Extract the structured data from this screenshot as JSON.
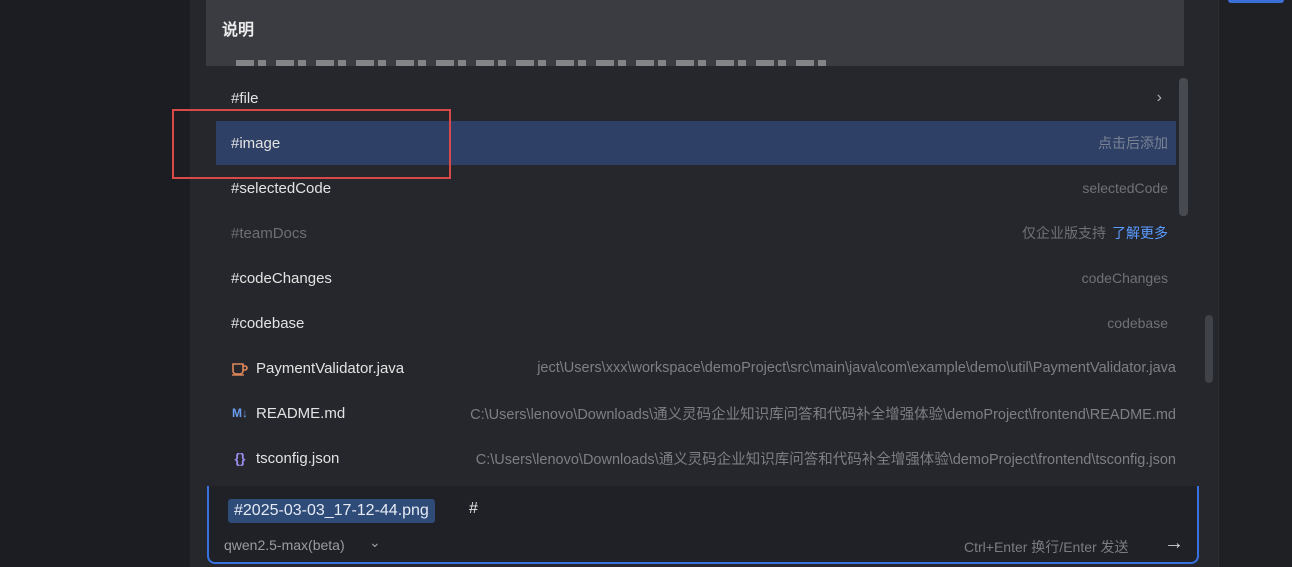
{
  "header": {
    "title": "说明"
  },
  "dropdown": {
    "items": [
      {
        "label": "#file",
        "right": "",
        "chevron": "›"
      },
      {
        "label": "#image",
        "right": "点击后添加",
        "selected": true
      },
      {
        "label": "#selectedCode",
        "right": "selectedCode"
      },
      {
        "label": "#teamDocs",
        "right": "仅企业版支持",
        "link": "了解更多",
        "disabled": true
      },
      {
        "label": "#codeChanges",
        "right": "codeChanges"
      },
      {
        "label": "#codebase",
        "right": "codebase"
      }
    ],
    "files": [
      {
        "name": "PaymentValidator.java",
        "path": "ject\\Users\\xxx\\workspace\\demoProject\\src\\main\\java\\com\\example\\demo\\util\\PaymentValidator.java",
        "icon": "java-cup-icon"
      },
      {
        "name": "README.md",
        "path": "C:\\Users\\lenovo\\Downloads\\通义灵码企业知识库问答和代码补全增强体验\\demoProject\\frontend\\README.md",
        "icon": "markdown-icon",
        "icon_text": "M↓"
      },
      {
        "name": "tsconfig.json",
        "path": "C:\\Users\\lenovo\\Downloads\\通义灵码企业知识库问答和代码补全增强体验\\demoProject\\frontend\\tsconfig.json",
        "icon": "json-braces-icon",
        "icon_text": "{}"
      }
    ]
  },
  "input": {
    "tag": "#2025-03-03_17-12-44.png",
    "typed": "#",
    "model": "qwen2.5-max(beta)",
    "send_hint": "Ctrl+Enter 换行/Enter 发送"
  },
  "colors": {
    "accent": "#3772e0",
    "selected_row": "#2e4066",
    "highlight_box": "#d84a4a",
    "link": "#5a9bff"
  }
}
